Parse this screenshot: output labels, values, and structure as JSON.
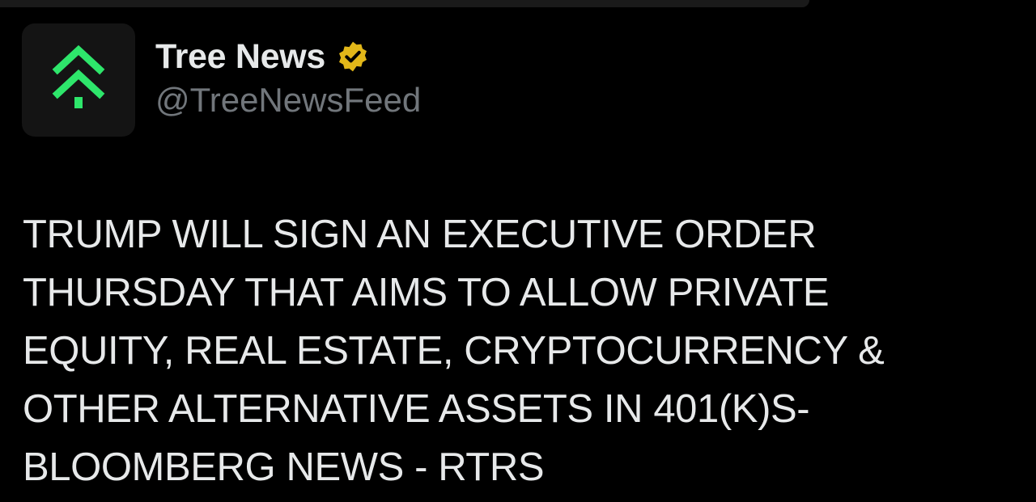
{
  "author": {
    "display_name": "Tree News",
    "handle": "@TreeNewsFeed",
    "avatar_icon": "tree-news-logo-icon",
    "verified_icon": "verified-badge-icon",
    "verified_color": "#e2b719"
  },
  "tweet": {
    "lines": [
      "TRUMP WILL SIGN AN EXECUTIVE ORDER",
      "THURSDAY THAT AIMS TO ALLOW PRIVATE",
      "EQUITY, REAL ESTATE, CRYPTOCURRENCY &",
      "OTHER ALTERNATIVE ASSETS IN 401(K)S-",
      "BLOOMBERG NEWS - RTRS"
    ]
  },
  "colors": {
    "background": "#000000",
    "text": "#e7e9ea",
    "secondary_text": "#71767b",
    "logo_green": "#2ee66b"
  }
}
